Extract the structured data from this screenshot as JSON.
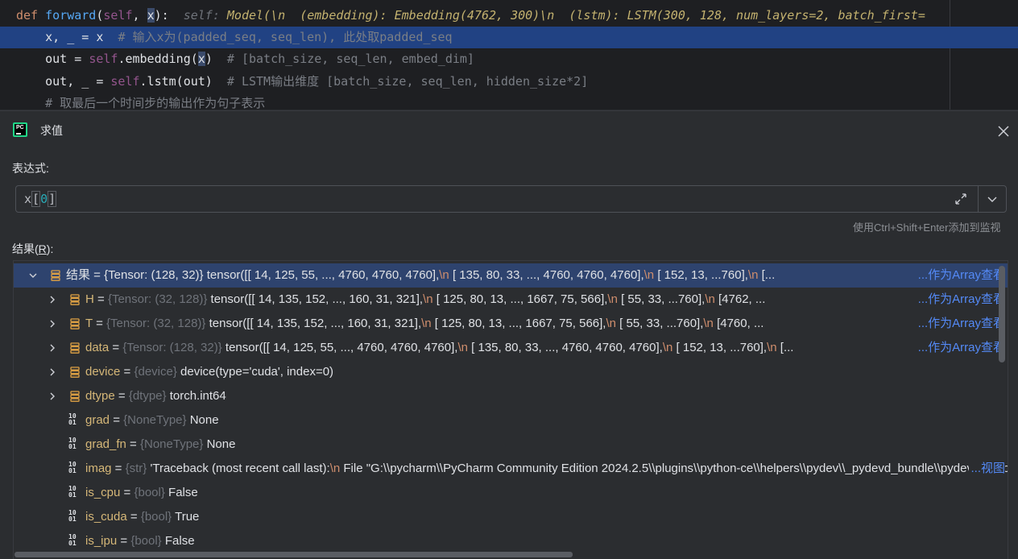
{
  "editor": {
    "lines": [
      [
        {
          "t": "def ",
          "c": "kw"
        },
        {
          "t": "forward",
          "c": "fn"
        },
        {
          "t": "(",
          "c": ""
        },
        {
          "t": "self",
          "c": "self"
        },
        {
          "t": ", ",
          "c": ""
        },
        {
          "t": "x",
          "c": "caretsel"
        },
        {
          "t": "):  ",
          "c": ""
        },
        {
          "t": "self: ",
          "c": "hint"
        },
        {
          "t": "Model(\\n  (embedding): Embedding(4762, 300)\\n  (lstm): LSTM(300, 128, num_layers=2, batch_first=",
          "c": "hintval"
        }
      ],
      [
        {
          "t": "    x, _ = x  ",
          "c": ""
        },
        {
          "t": "# 输入x为(padded_seq, seq_len), 此处取padded_seq",
          "c": "cm"
        }
      ],
      [
        {
          "t": "    out = ",
          "c": ""
        },
        {
          "t": "self",
          "c": "self"
        },
        {
          "t": ".embedding(",
          "c": ""
        },
        {
          "t": "x",
          "c": "caretsel"
        },
        {
          "t": ")  ",
          "c": ""
        },
        {
          "t": "# [batch_size, seq_len, embed_dim]",
          "c": "cm"
        }
      ],
      [
        {
          "t": "    out, _ = ",
          "c": ""
        },
        {
          "t": "self",
          "c": "self"
        },
        {
          "t": ".lstm(out)  ",
          "c": ""
        },
        {
          "t": "# LSTM输出维度 [batch_size, seq_len, hidden_size*2]",
          "c": "cm"
        }
      ],
      [
        {
          "t": "    ",
          "c": ""
        },
        {
          "t": "# 取最后一个时间步的输出作为句子表示",
          "c": "cm"
        }
      ]
    ]
  },
  "dialog": {
    "title": "求值",
    "expression_label": "表达式:",
    "expression_prefix": "x",
    "expression_index": "0",
    "shortcut_hint": "使用Ctrl+Shift+Enter添加到监视",
    "result_label": "结果(",
    "result_label_key": "R",
    "result_label_suffix": "):"
  },
  "tree": {
    "rows": [
      {
        "level": 0,
        "expander": "expanded",
        "icon": "list",
        "selected": true,
        "name": "结果",
        "type": "{Tensor: (128, 32)}",
        "value": "tensor([[  14,  125,   55,  ..., 4760, 4760, 4760],\\n        [ 135,   80,   33,  ..., 4760, 4760, 4760],\\n        [ 152,   13,  ...760],\\n        [...",
        "link": "...作为Array查看"
      },
      {
        "level": 1,
        "expander": "collapsed",
        "icon": "list",
        "selected": false,
        "name": "H",
        "type": "{Tensor: (32, 128)}",
        "value": "tensor([[  14,  135,  152,  ...,  160,   31,  321],\\n        [ 125,   80,   13,  ..., 1667,   75,  566],\\n        [  55,   33,  ...760],\\n        [4762, ...",
        "link": "...作为Array查看"
      },
      {
        "level": 1,
        "expander": "collapsed",
        "icon": "list",
        "selected": false,
        "name": "T",
        "type": "{Tensor: (32, 128)}",
        "value": "tensor([[  14,  135,  152,  ...,  160,   31,  321],\\n        [ 125,   80,   13,  ..., 1667,   75,  566],\\n        [  55,   33,  ...760],\\n        [4760, ...",
        "link": "...作为Array查看"
      },
      {
        "level": 1,
        "expander": "collapsed",
        "icon": "list",
        "selected": false,
        "name": "data",
        "type": "{Tensor: (128, 32)}",
        "value": "tensor([[  14,  125,   55,  ..., 4760, 4760, 4760],\\n        [ 135,   80,   33,  ..., 4760, 4760, 4760],\\n        [ 152,   13,  ...760],\\n        [...",
        "link": "...作为Array查看"
      },
      {
        "level": 1,
        "expander": "collapsed",
        "icon": "list",
        "selected": false,
        "name": "device",
        "type": "{device}",
        "value": "device(type='cuda', index=0)",
        "link": ""
      },
      {
        "level": 1,
        "expander": "collapsed",
        "icon": "list",
        "selected": false,
        "name": "dtype",
        "type": "{dtype}",
        "value": "torch.int64",
        "link": ""
      },
      {
        "level": 1,
        "expander": "none",
        "icon": "num",
        "selected": false,
        "name": "grad",
        "type": "{NoneType}",
        "value": "None",
        "link": ""
      },
      {
        "level": 1,
        "expander": "none",
        "icon": "num",
        "selected": false,
        "name": "grad_fn",
        "type": "{NoneType}",
        "value": "None",
        "link": ""
      },
      {
        "level": 1,
        "expander": "none",
        "icon": "num",
        "selected": false,
        "name": "imag",
        "type": "{str}",
        "value": "'Traceback (most recent call last):\\n  File \"G:\\\\pycharm\\\\PyCharm Community Edition 2024.2.5\\\\plugins\\\\python-ce\\\\helpers\\\\pydev\\\\_pydevd_bundle\\\\pydevd_resolver.py\"",
        "link": "...视图"
      },
      {
        "level": 1,
        "expander": "none",
        "icon": "num",
        "selected": false,
        "name": "is_cpu",
        "type": "{bool}",
        "value": "False",
        "link": ""
      },
      {
        "level": 1,
        "expander": "none",
        "icon": "num",
        "selected": false,
        "name": "is_cuda",
        "type": "{bool}",
        "value": "True",
        "link": ""
      },
      {
        "level": 1,
        "expander": "none",
        "icon": "num",
        "selected": false,
        "name": "is_ipu",
        "type": "{bool}",
        "value": "False",
        "link": ""
      }
    ]
  },
  "colors": {
    "accent": "#548af7",
    "selection": "#2e436e",
    "editor_highlight": "#214283",
    "field_name": "#d5b778",
    "escape": "#cf8e6d"
  },
  "icons": {
    "app": "pycharm-icon",
    "close": "close-icon",
    "expand": "expand-icon",
    "history": "chevron-down-icon",
    "list_var": "list-variable-icon",
    "num_var": "number-variable-icon"
  }
}
